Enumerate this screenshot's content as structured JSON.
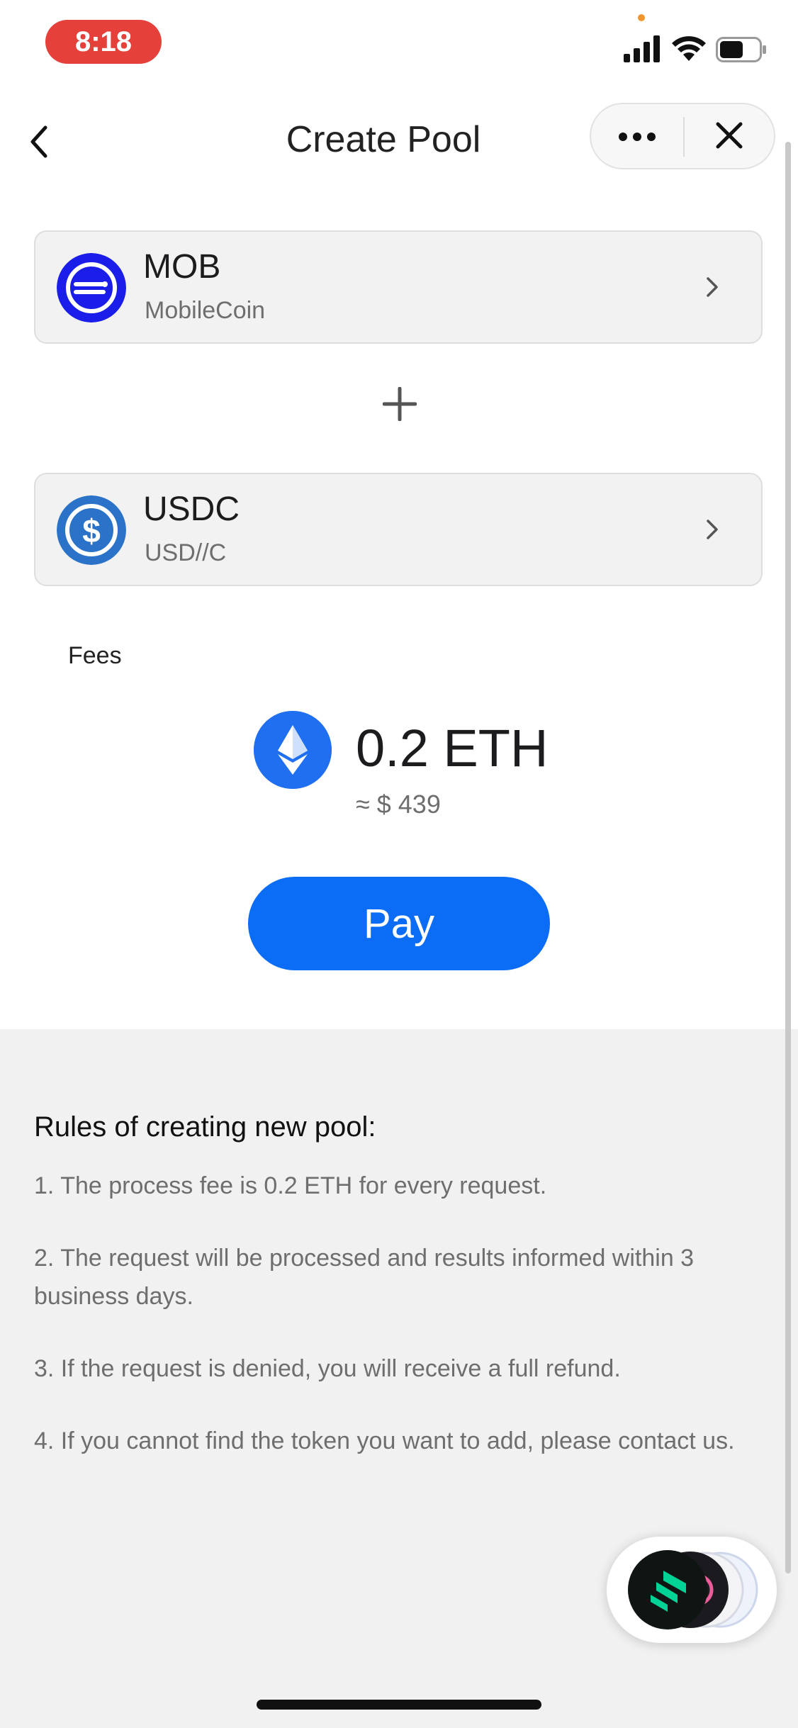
{
  "status_bar": {
    "time": "8:18"
  },
  "header": {
    "title": "Create Pool"
  },
  "tokens": [
    {
      "symbol": "MOB",
      "name": "MobileCoin",
      "logo_color": "#1a1ee8",
      "icon": "mobilecoin-logo-icon"
    },
    {
      "symbol": "USDC",
      "name": "USD//C",
      "logo_color": "#2a73c9",
      "icon": "usdc-logo-icon"
    }
  ],
  "fees": {
    "label": "Fees",
    "amount": "0.2 ETH",
    "usd_equivalent": "≈ $ 439",
    "icon": "ethereum-logo-icon"
  },
  "pay_button": {
    "label": "Pay",
    "color": "#0b6cf5"
  },
  "rules": {
    "title": "Rules of creating new pool:",
    "items": [
      "1. The process fee is 0.2 ETH for every request.",
      "2. The request will be processed and results informed within 3 business days.",
      "3. If the request is denied, you will receive a full refund.",
      "4. If you cannot find the token you want to add, please contact us."
    ]
  }
}
